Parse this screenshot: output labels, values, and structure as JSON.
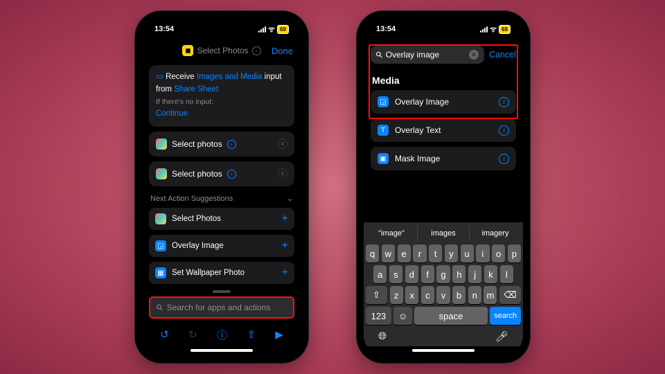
{
  "status": {
    "time": "13:54",
    "battery": "69"
  },
  "phone1": {
    "nav": {
      "title": "Select Photos",
      "done": "Done"
    },
    "receive": {
      "prefix": "Receive",
      "types": "Images and Media",
      "mid": "input from",
      "source": "Share Sheet",
      "noInputLabel": "If there's no input:",
      "noInputAction": "Continue"
    },
    "actions": [
      {
        "label": "Select photos"
      },
      {
        "label": "Select photos"
      }
    ],
    "suggestionsHeader": "Next Action Suggestions",
    "suggestions": [
      {
        "label": "Select Photos",
        "icon": "multi"
      },
      {
        "label": "Overlay Image",
        "icon": "blue"
      },
      {
        "label": "Set Wallpaper Photo",
        "icon": "blue"
      }
    ],
    "searchPlaceholder": "Search for apps and actions"
  },
  "phone2": {
    "search": {
      "query": "Overlay image",
      "cancel": "Cancel"
    },
    "categoryHeader": "Media",
    "results": [
      {
        "label": "Overlay Image"
      },
      {
        "label": "Overlay Text"
      },
      {
        "label": "Mask Image"
      }
    ],
    "kbdSuggestions": [
      "\"image\"",
      "images",
      "imagery"
    ],
    "kbd": {
      "r1": [
        "q",
        "w",
        "e",
        "r",
        "t",
        "y",
        "u",
        "i",
        "o",
        "p"
      ],
      "r2": [
        "a",
        "s",
        "d",
        "f",
        "g",
        "h",
        "j",
        "k",
        "l"
      ],
      "r3": [
        "z",
        "x",
        "c",
        "v",
        "b",
        "n",
        "m"
      ],
      "numKey": "123",
      "space": "space",
      "search": "search"
    }
  }
}
